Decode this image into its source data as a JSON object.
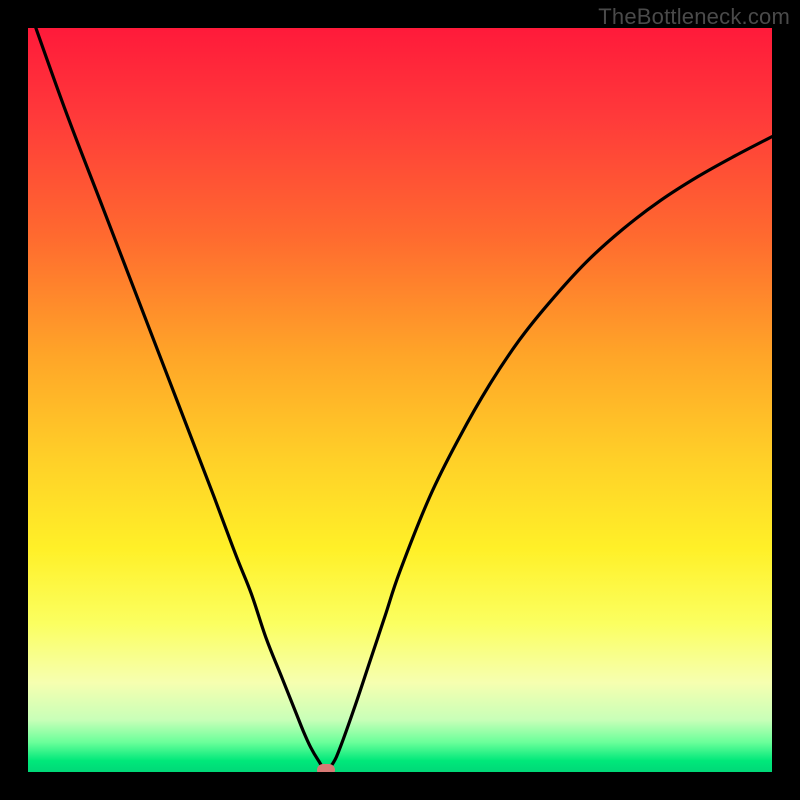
{
  "watermark": "TheBottleneck.com",
  "colors": {
    "frame": "#000000",
    "curve": "#000000",
    "marker": "#d77a75"
  },
  "chart_data": {
    "type": "line",
    "title": "",
    "xlabel": "",
    "ylabel": "",
    "xlim": [
      0,
      100
    ],
    "ylim": [
      0,
      100
    ],
    "grid": false,
    "series": [
      {
        "name": "bottleneck-curve",
        "x": [
          0,
          5,
          10,
          15,
          20,
          25,
          28,
          30,
          32,
          34,
          36,
          37,
          38,
          39,
          40,
          41,
          42,
          44,
          46,
          48,
          50,
          54,
          58,
          62,
          66,
          70,
          75,
          80,
          85,
          90,
          95,
          100
        ],
        "y": [
          103,
          89,
          76,
          63,
          50,
          37,
          29,
          24,
          18,
          13,
          8,
          5.5,
          3.3,
          1.6,
          0.3,
          1.2,
          3.4,
          9,
          15,
          21,
          27,
          37,
          45,
          52,
          58,
          63,
          68.5,
          73,
          76.8,
          80,
          82.8,
          85.4
        ]
      }
    ],
    "markers": [
      {
        "name": "minpoint",
        "x": 40,
        "y": 0.3
      }
    ],
    "background_gradient": {
      "top": "#ff1a3a",
      "bottom": "#00d878"
    }
  }
}
